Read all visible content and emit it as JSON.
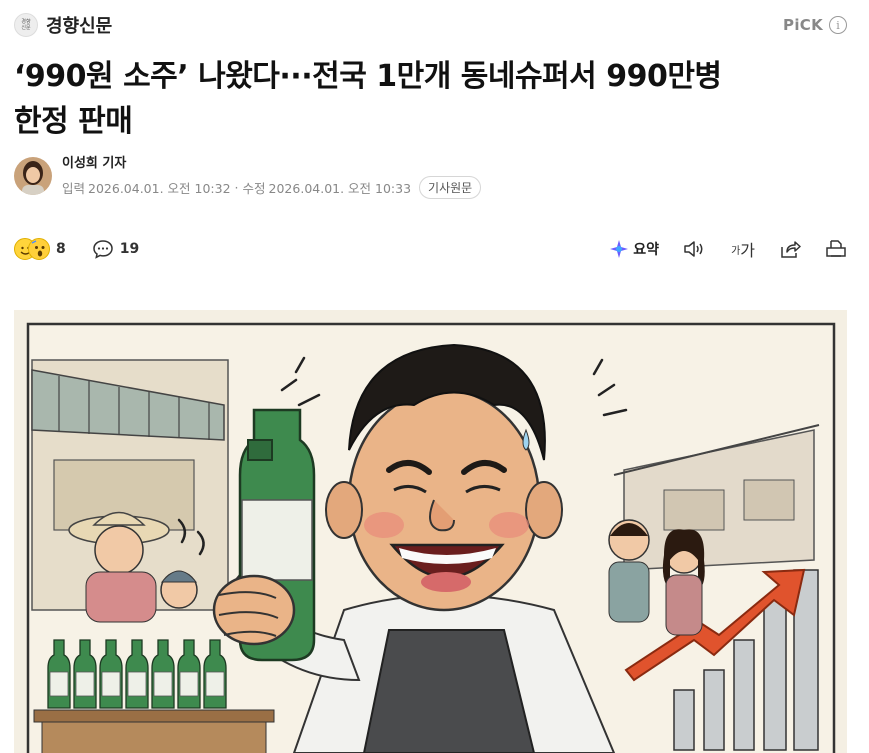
{
  "header": {
    "press_logo_text": "경향\n신문",
    "press_name": "경향신문",
    "pick_label": "PiCK",
    "info_icon": "info-icon"
  },
  "article": {
    "headline_line1": "‘990원 소주’ 나왔다···전국 1만개 동네슈퍼서 990만병",
    "headline_line2": "한정 판매"
  },
  "byline": {
    "reporter": "이성희 기자",
    "published_label": "입력",
    "published": "2026.04.01. 오전 10:32",
    "separator": "·",
    "modified_label": "수정",
    "modified": "2026.04.01. 오전 10:33",
    "original_link": "기사원문"
  },
  "toolbar": {
    "reaction_count": "8",
    "comment_count": "19",
    "summary_label": "요약",
    "font_small": "가",
    "font_big": "가"
  },
  "colors": {
    "accent_summary": "#6b5cff",
    "muted_text": "#888888",
    "chart_arrow": "#e0532d"
  }
}
